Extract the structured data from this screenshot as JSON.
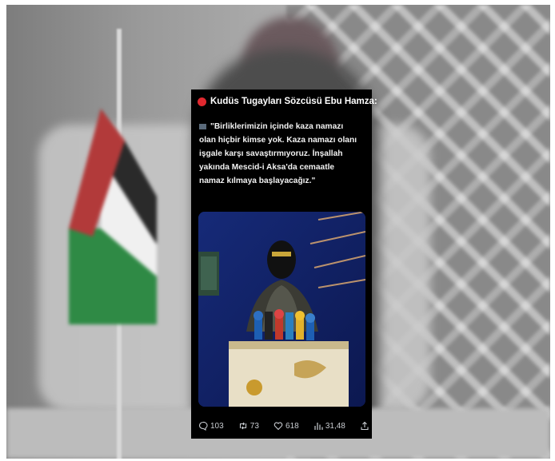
{
  "tweet": {
    "header": "Kudüs Tugayları Sözcüsü Ebu Hamza:",
    "quote_lines": [
      "\"Birliklerimizin içinde kaza namazı",
      "olan hiçbir kimse yok. Kaza namazı olanı",
      "işgale karşı savaştırmıyoruz. İnşallah",
      "yakında Mescid-i Aksa'da cemaatle",
      "namaz kılmaya başlayacağız.\""
    ],
    "stats": {
      "replies": "103",
      "retweets": "73",
      "likes": "618",
      "views": "31,48"
    }
  },
  "icons": {
    "header": "red-circle-icon",
    "quote": "quote-marker-icon",
    "actions": [
      "reply-icon",
      "retweet-icon",
      "like-icon",
      "views-icon",
      "share-icon"
    ]
  },
  "colors": {
    "card_background": "#000000",
    "header_dot": "#e0282f",
    "action_text": "#c9cdd2",
    "photo_background": "#1a2b6b"
  }
}
